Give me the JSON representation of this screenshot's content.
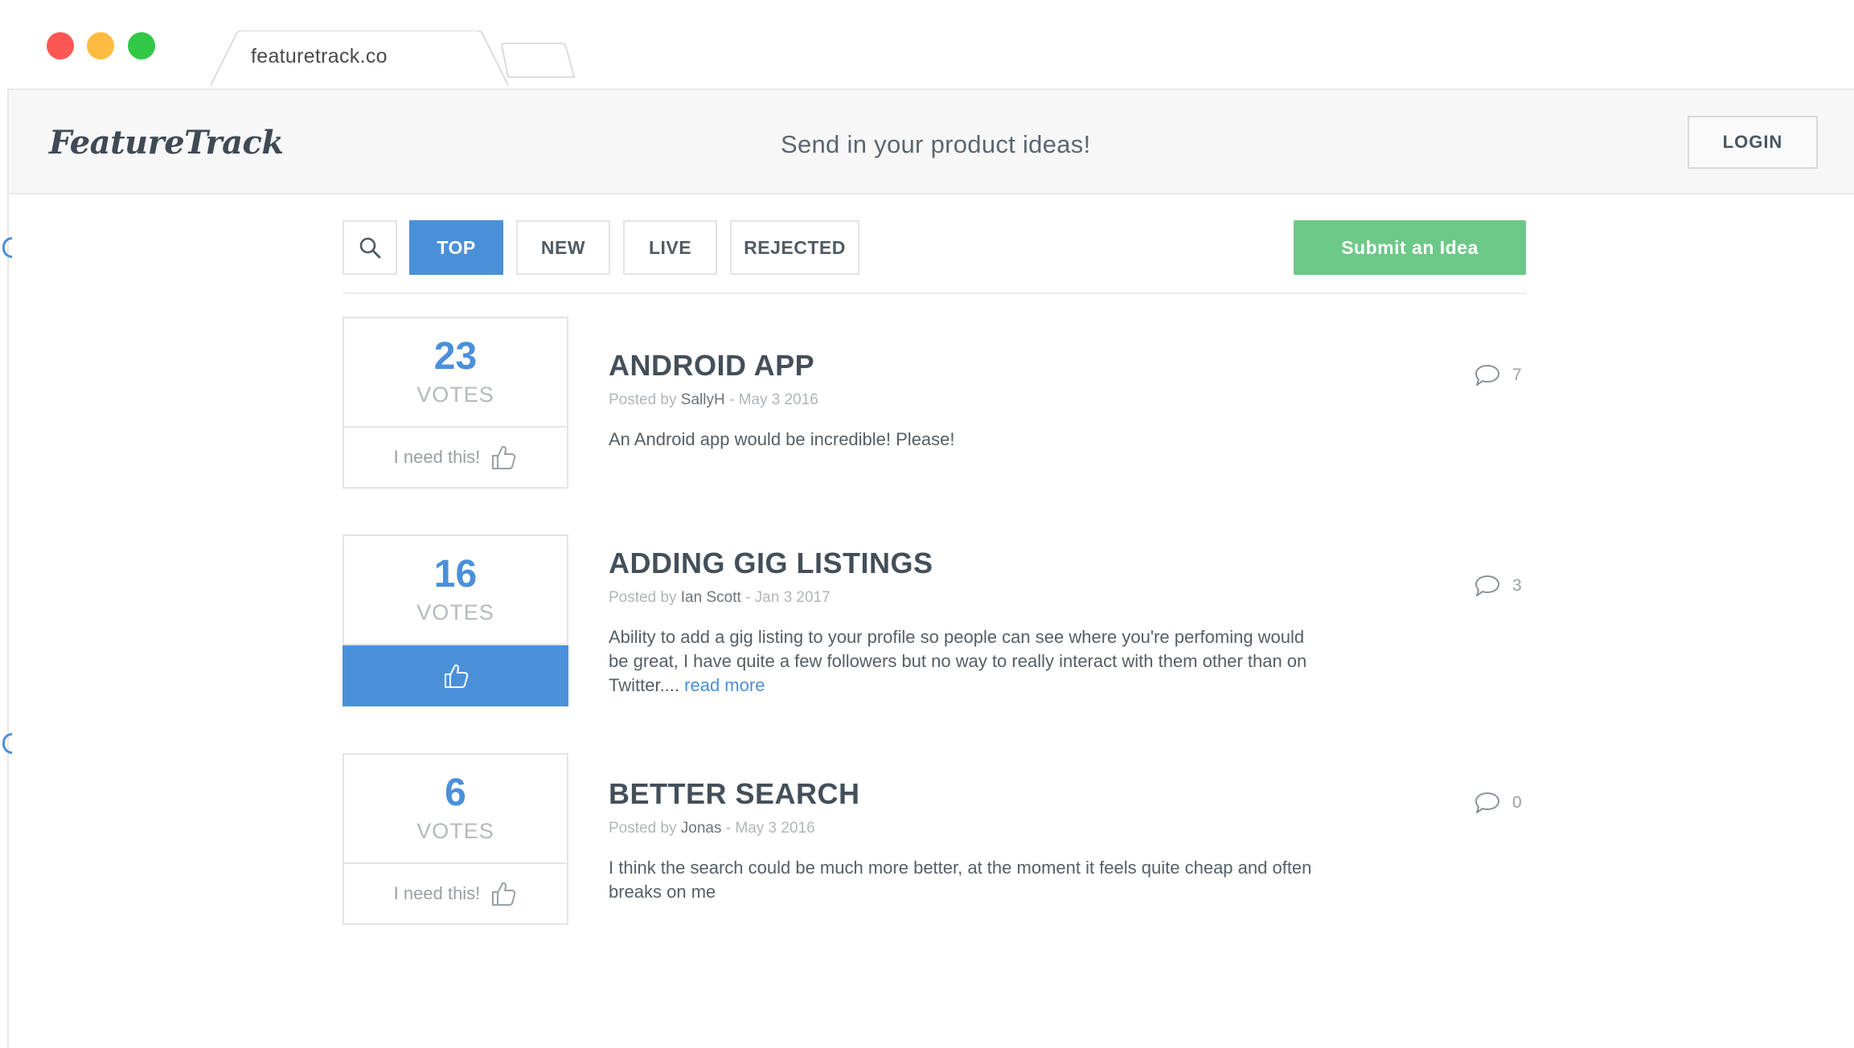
{
  "browser": {
    "tab_title": "featuretrack.co"
  },
  "header": {
    "logo": "FeatureTrack",
    "tagline": "Send in your product ideas!",
    "login_label": "LOGIN"
  },
  "toolbar": {
    "search_icon": "search-icon",
    "tabs": [
      {
        "label": "TOP",
        "active": true
      },
      {
        "label": "NEW",
        "active": false
      },
      {
        "label": "LIVE",
        "active": false
      },
      {
        "label": "REJECTED",
        "active": false
      }
    ],
    "submit_label": "Submit an Idea"
  },
  "ideas": [
    {
      "votes": "23",
      "votes_label": "VOTES",
      "action_label": "I need this!",
      "voted": false,
      "title": "ANDROID APP",
      "posted_by": "Posted by",
      "author": "SallyH",
      "date": "- May 3 2016",
      "body": "An Android app would be incredible! Please!",
      "read_more": "",
      "comments": "7"
    },
    {
      "votes": "16",
      "votes_label": "VOTES",
      "action_label": "",
      "voted": true,
      "title": "ADDING GIG LISTINGS",
      "posted_by": "Posted by",
      "author": "Ian Scott",
      "date": "- Jan 3 2017",
      "body": "Ability to add a gig listing to your profile so people can see where you're perfoming would be great, I have quite a few followers but no way to really interact with them other than on Twitter....",
      "read_more": "read more",
      "comments": "3"
    },
    {
      "votes": "6",
      "votes_label": "VOTES",
      "action_label": "I need this!",
      "voted": false,
      "title": "BETTER SEARCH",
      "posted_by": "Posted by",
      "author": "Jonas",
      "date": "- May 3 2016",
      "body": "I think the search could be much more better, at the moment it feels quite cheap and often breaks on me",
      "read_more": "",
      "comments": "0"
    }
  ],
  "colors": {
    "accent_blue": "#4a90d9",
    "submit_green": "#6cc887",
    "close_red": "#fc5753",
    "minimize_yellow": "#fdbc40",
    "maximize_green": "#33c748"
  }
}
